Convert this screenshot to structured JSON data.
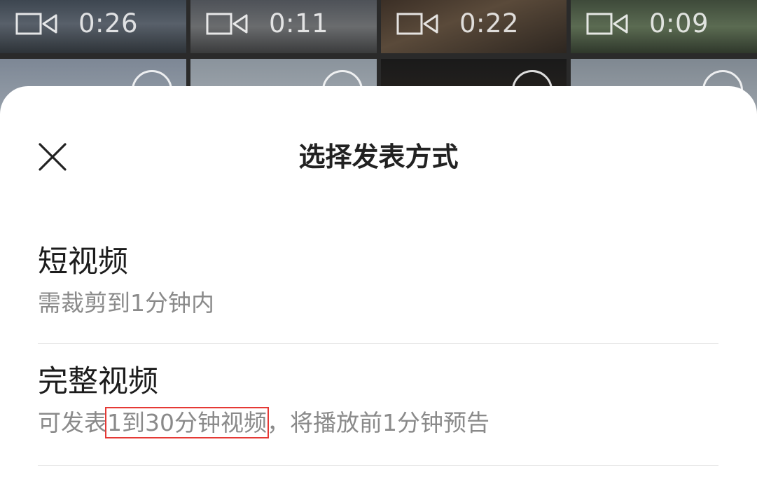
{
  "background_grid": {
    "row1_durations": [
      "0:26",
      "0:11",
      "0:22",
      "0:09"
    ]
  },
  "sheet": {
    "title": "选择发表方式",
    "close_icon": "close-icon",
    "options": [
      {
        "title": "短视频",
        "desc": "需裁剪到1分钟内"
      },
      {
        "title": "完整视频",
        "desc_prefix": "可发表",
        "desc_highlight": "1到30分钟视频",
        "desc_suffix": "，将播放前1分钟预告"
      }
    ]
  },
  "colors": {
    "sheet_bg": "#ffffff",
    "title_text": "#222222",
    "secondary_text": "#8a8a8a",
    "highlight_box": "#e53935"
  }
}
